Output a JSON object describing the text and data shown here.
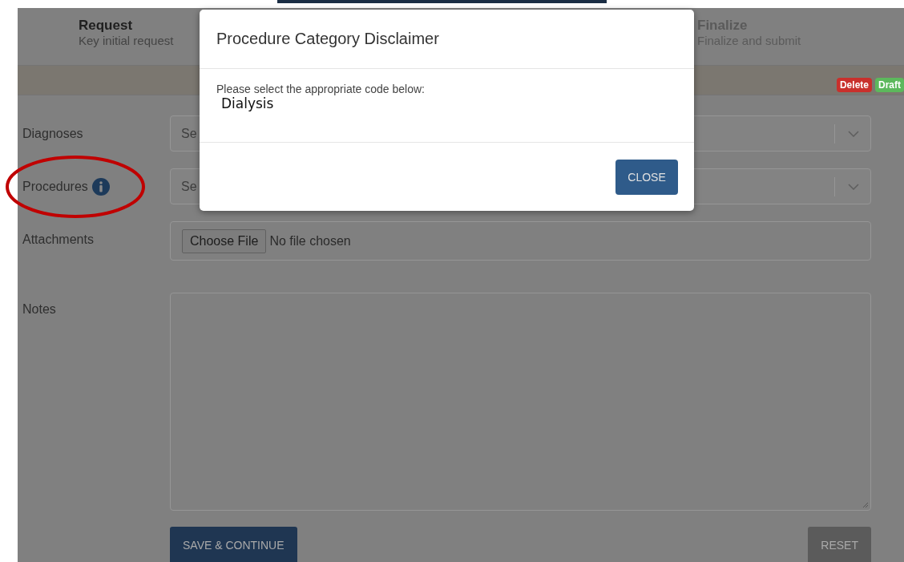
{
  "steps": [
    {
      "title": "Request",
      "subtitle": "Key initial request"
    },
    {
      "title": "Finalize",
      "subtitle": "Finalize and submit"
    }
  ],
  "badges": [
    {
      "label": "Delete",
      "color": "#c9302c"
    },
    {
      "label": "Draft",
      "color": "#5cb85c"
    }
  ],
  "form": {
    "fields": [
      {
        "kind": "select",
        "label": "Diagnoses",
        "placeholder": "Se",
        "info": false
      },
      {
        "kind": "select",
        "label": "Procedures",
        "placeholder": "Se",
        "info": true,
        "highlighted": true
      },
      {
        "kind": "file",
        "label": "Attachments",
        "button": "Choose File",
        "status": "No file chosen",
        "info": false
      },
      {
        "kind": "textarea",
        "label": "Notes",
        "info": false
      }
    ],
    "buttons": [
      {
        "label": "SAVE & CONTINUE",
        "kind": "primary"
      },
      {
        "label": "RESET",
        "kind": "secondary"
      }
    ]
  },
  "dialog": {
    "title": "Procedure Category Disclaimer",
    "message": "Please select the appropriate code below:",
    "code": "Dialysis",
    "button": "CLOSE"
  }
}
